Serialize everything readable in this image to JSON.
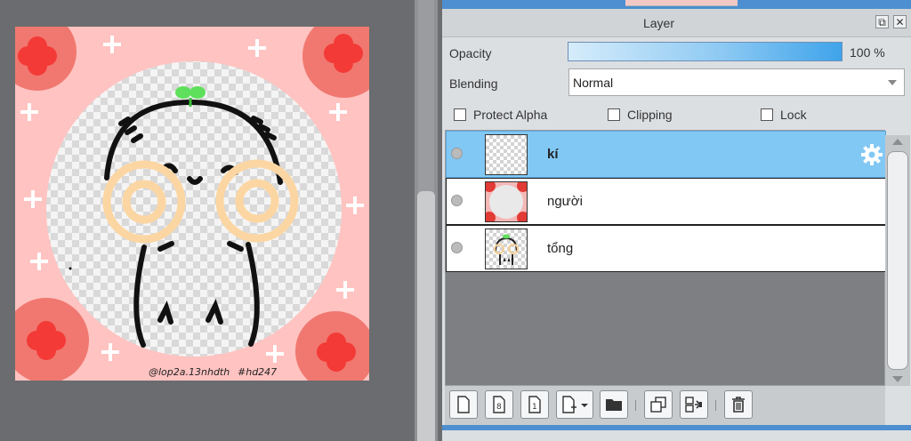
{
  "panel": {
    "title": "Layer",
    "opacity_label": "Opacity",
    "opacity_value": "100 %",
    "opacity_fraction": 1.0,
    "blending_label": "Blending",
    "blending_value": "Normal",
    "checkboxes": {
      "protect_alpha": "Protect Alpha",
      "clipping": "Clipping",
      "lock": "Lock"
    },
    "layers": [
      {
        "name": "kí",
        "selected": true
      },
      {
        "name": "người",
        "selected": false
      },
      {
        "name": "tổng",
        "selected": false
      }
    ]
  },
  "artwork": {
    "signature": "@lop2a.13nhdth",
    "tag": "#hd247"
  },
  "icons": [
    "maximize-icon",
    "close-icon",
    "visibility-dot-icon",
    "gear-icon",
    "new-layer-icon",
    "new-8bit-layer-icon",
    "new-1bit-layer-icon",
    "new-special-layer-icon",
    "folder-icon",
    "duplicate-icon",
    "merge-down-icon",
    "trash-icon"
  ],
  "colors": {
    "selection": "#82c8f5",
    "opacity_bar": "#3fa4ea",
    "canvas_bg": "#ffc3c1",
    "accent_red": "#f3504a"
  }
}
